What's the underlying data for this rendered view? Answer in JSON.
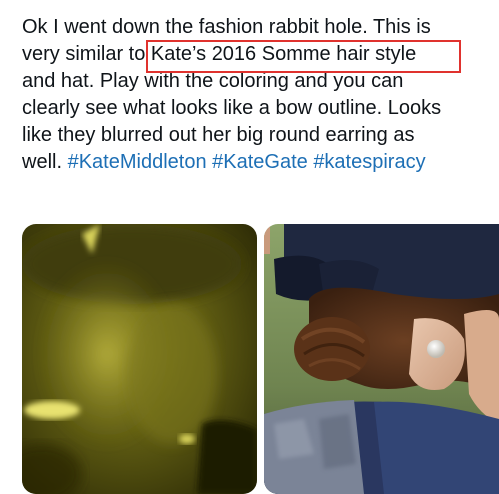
{
  "tweet": {
    "text_lines": [
      "Ok I went down the fashion rabbit hole. This is",
      "very similar to Kate’s 2016 Somme hair style",
      "and hat. Play with the coloring and you can",
      "clearly see what looks like a bow outline. Looks",
      "like they blurred out her big round earring as"
    ],
    "last_line_prefix": "well.",
    "hashtags": [
      "#KateMiddleton",
      "#KateGate",
      "#katespiracy"
    ],
    "highlighted_phrase": "Kate’s 2016 Somme hair style",
    "highlight_color": "#e0322e",
    "hashtag_color": "#1d6fb5"
  },
  "media": {
    "images": [
      {
        "name": "edited-photo-yellow-tint",
        "alt": ""
      },
      {
        "name": "somme-2016-photo",
        "alt": ""
      }
    ]
  }
}
